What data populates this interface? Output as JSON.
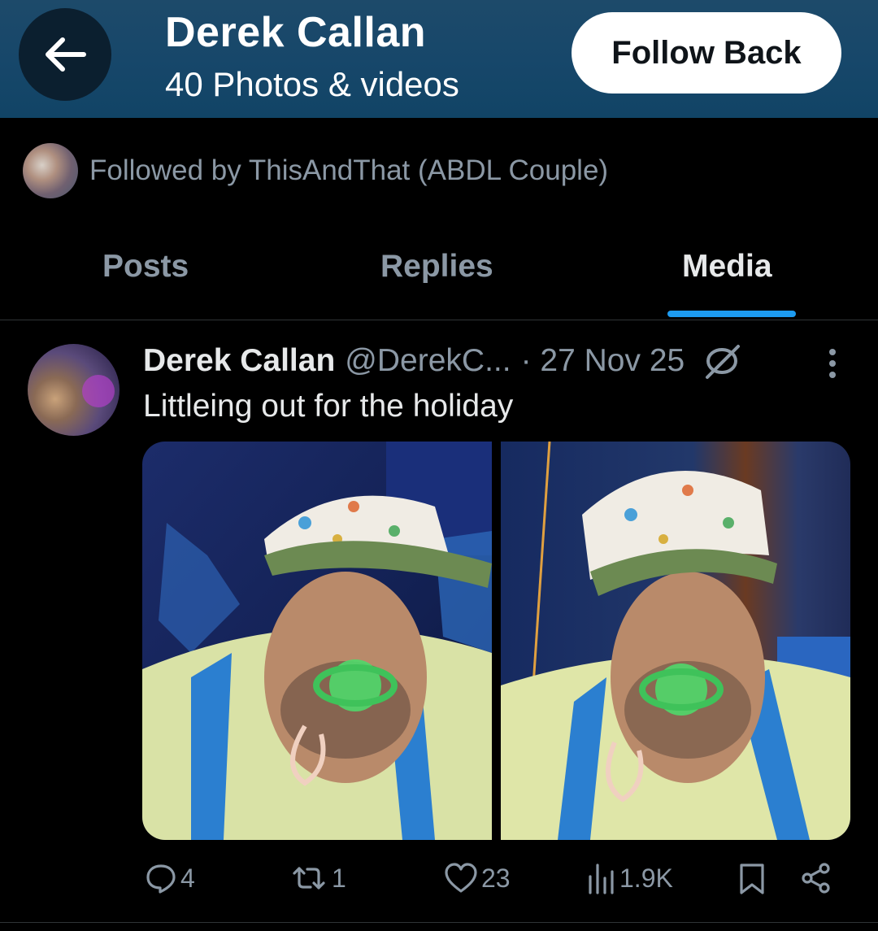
{
  "header": {
    "name": "Derek Callan",
    "subtitle": "40 Photos & videos",
    "follow_label": "Follow Back",
    "back_icon": "arrow-left-icon"
  },
  "followed_by": {
    "text": "Followed by ThisAndThat (ABDL Couple)"
  },
  "tabs": [
    {
      "label": "Posts",
      "active": false
    },
    {
      "label": "Replies",
      "active": false
    },
    {
      "label": "Media",
      "active": true
    }
  ],
  "post": {
    "name": "Derek Callan",
    "handle": "@DerekC...",
    "date": "· 27 Nov 25",
    "text": "Littleing out for the holiday",
    "actions": {
      "replies": "4",
      "reposts": "1",
      "likes": "23",
      "views": "1.9K"
    }
  },
  "colors": {
    "header_bg": "#17476a",
    "accent": "#1d9bf0",
    "muted_text": "#8b98a5"
  }
}
